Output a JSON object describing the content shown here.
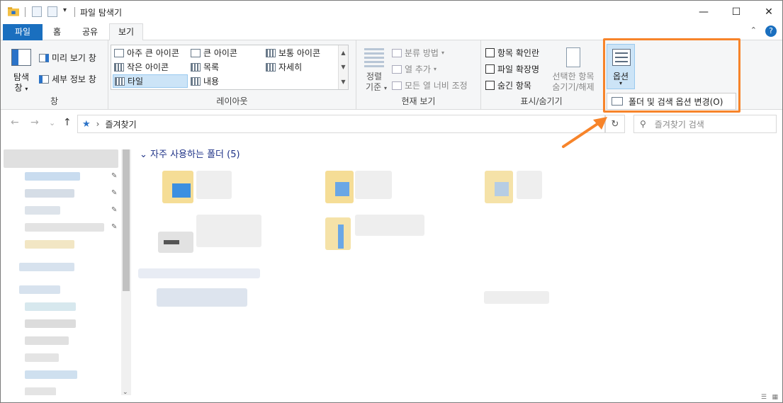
{
  "window": {
    "title": "파일 탐색기"
  },
  "winbtns": {
    "minimize": "—",
    "maximize": "☐",
    "close": "✕"
  },
  "tabs": [
    {
      "label": "파일"
    },
    {
      "label": "홈"
    },
    {
      "label": "공유"
    },
    {
      "label": "보기"
    }
  ],
  "tabs_right": {
    "collapse": "⌃",
    "help": "?"
  },
  "ribbon": {
    "pane_group": {
      "nav_pane": "탐색",
      "nav_pane2": "창",
      "preview_pane": "미리 보기 창",
      "details_pane": "세부 정보 창",
      "label": "창"
    },
    "layout_group": {
      "items": [
        "아주 큰 아이콘",
        "큰 아이콘",
        "보통 아이콘",
        "작은 아이콘",
        "목록",
        "자세히",
        "타일",
        "내용"
      ],
      "label": "레이아웃"
    },
    "current_view_group": {
      "sort_by": "정렬",
      "sort_by2": "기준",
      "group_by": "분류 방법",
      "add_columns": "열 추가",
      "fit_columns": "모든 열 너비 조정",
      "label": "현재 보기"
    },
    "show_hide_group": {
      "item_checkboxes": "항목 확인란",
      "file_extensions": "파일 확장명",
      "hidden_items": "숨긴 항목",
      "hide_selected": "선택한 항목",
      "hide_selected2": "숨기기/해제",
      "label": "표시/숨기기"
    },
    "options": {
      "label": "옵션",
      "caret": "▾",
      "change_folder_options": "폴더 및 검색 옵션 변경(O)"
    }
  },
  "nav": {
    "back": "←",
    "forward": "→",
    "recent": "⌄",
    "up": "↑",
    "separator": "›",
    "location": "즐겨찾기",
    "refresh": "↻",
    "search_placeholder": "즐겨찾기 검색"
  },
  "content": {
    "frequent_folders": "자주 사용하는 폴더 (5)"
  },
  "colors": {
    "accent": "#1a6fbf",
    "highlight": "#f7842a",
    "selection": "#cce4f7"
  }
}
